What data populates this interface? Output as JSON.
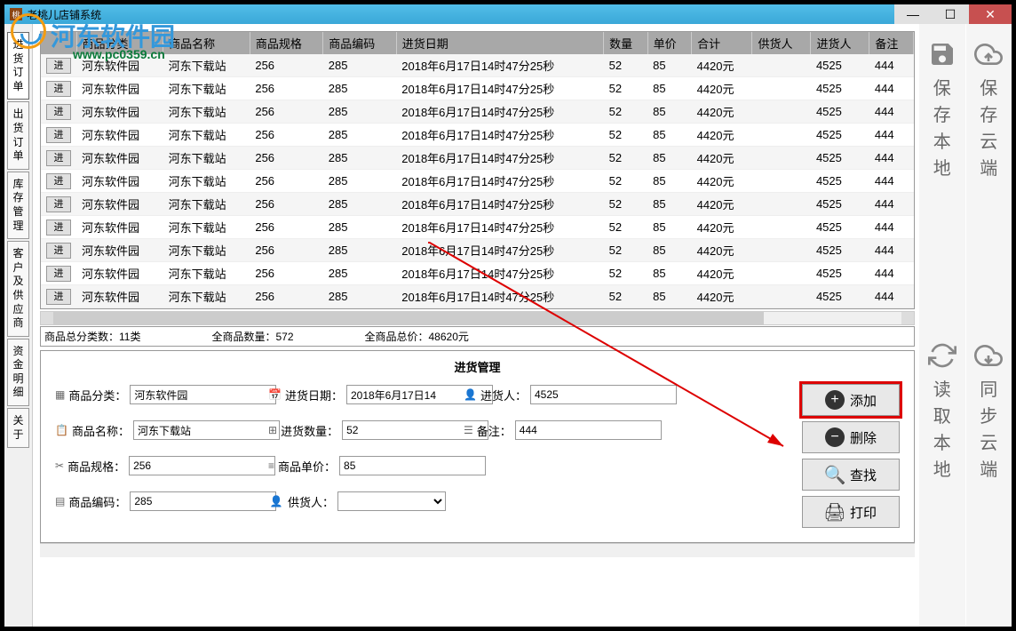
{
  "window": {
    "title": "老桃儿店铺系统",
    "icon_char": "桃"
  },
  "watermark": {
    "text": "河东软件园",
    "url": "www.pc0359.cn"
  },
  "nav_items": [
    {
      "label": "进货订单",
      "active": true
    },
    {
      "label": "出货订单",
      "active": false
    },
    {
      "label": "库存管理",
      "active": false
    },
    {
      "label": "客户及供应商",
      "active": false
    },
    {
      "label": "资金明细",
      "active": false
    },
    {
      "label": "关于",
      "active": false
    }
  ],
  "table": {
    "headers": [
      "",
      "商品分类",
      "商品名称",
      "商品规格",
      "商品编码",
      "进货日期",
      "数量",
      "单价",
      "合计",
      "供货人",
      "进货人",
      "备注"
    ],
    "row_btn": "进",
    "rows": [
      {
        "category": "河东软件园",
        "name": "河东下载站",
        "spec": "256",
        "code": "285",
        "date": "2018年6月17日14时47分25秒",
        "qty": "52",
        "price": "85",
        "total": "4420元",
        "supplier": "",
        "buyer": "4525",
        "remark": "444"
      },
      {
        "category": "河东软件园",
        "name": "河东下载站",
        "spec": "256",
        "code": "285",
        "date": "2018年6月17日14时47分25秒",
        "qty": "52",
        "price": "85",
        "total": "4420元",
        "supplier": "",
        "buyer": "4525",
        "remark": "444"
      },
      {
        "category": "河东软件园",
        "name": "河东下载站",
        "spec": "256",
        "code": "285",
        "date": "2018年6月17日14时47分25秒",
        "qty": "52",
        "price": "85",
        "total": "4420元",
        "supplier": "",
        "buyer": "4525",
        "remark": "444"
      },
      {
        "category": "河东软件园",
        "name": "河东下载站",
        "spec": "256",
        "code": "285",
        "date": "2018年6月17日14时47分25秒",
        "qty": "52",
        "price": "85",
        "total": "4420元",
        "supplier": "",
        "buyer": "4525",
        "remark": "444"
      },
      {
        "category": "河东软件园",
        "name": "河东下载站",
        "spec": "256",
        "code": "285",
        "date": "2018年6月17日14时47分25秒",
        "qty": "52",
        "price": "85",
        "total": "4420元",
        "supplier": "",
        "buyer": "4525",
        "remark": "444"
      },
      {
        "category": "河东软件园",
        "name": "河东下载站",
        "spec": "256",
        "code": "285",
        "date": "2018年6月17日14时47分25秒",
        "qty": "52",
        "price": "85",
        "total": "4420元",
        "supplier": "",
        "buyer": "4525",
        "remark": "444"
      },
      {
        "category": "河东软件园",
        "name": "河东下载站",
        "spec": "256",
        "code": "285",
        "date": "2018年6月17日14时47分25秒",
        "qty": "52",
        "price": "85",
        "total": "4420元",
        "supplier": "",
        "buyer": "4525",
        "remark": "444"
      },
      {
        "category": "河东软件园",
        "name": "河东下载站",
        "spec": "256",
        "code": "285",
        "date": "2018年6月17日14时47分25秒",
        "qty": "52",
        "price": "85",
        "total": "4420元",
        "supplier": "",
        "buyer": "4525",
        "remark": "444"
      },
      {
        "category": "河东软件园",
        "name": "河东下载站",
        "spec": "256",
        "code": "285",
        "date": "2018年6月17日14时47分25秒",
        "qty": "52",
        "price": "85",
        "total": "4420元",
        "supplier": "",
        "buyer": "4525",
        "remark": "444"
      },
      {
        "category": "河东软件园",
        "name": "河东下载站",
        "spec": "256",
        "code": "285",
        "date": "2018年6月17日14时47分25秒",
        "qty": "52",
        "price": "85",
        "total": "4420元",
        "supplier": "",
        "buyer": "4525",
        "remark": "444"
      },
      {
        "category": "河东软件园",
        "name": "河东下载站",
        "spec": "256",
        "code": "285",
        "date": "2018年6月17日14时47分25秒",
        "qty": "52",
        "price": "85",
        "total": "4420元",
        "supplier": "",
        "buyer": "4525",
        "remark": "444"
      }
    ]
  },
  "stats": {
    "categories": "商品总分类数：11类",
    "total_count": "全商品数量：572",
    "total_price": "全商品总价：48620元"
  },
  "form": {
    "title": "进货管理",
    "fields": {
      "category_label": "商品分类：",
      "category_value": "河东软件园",
      "date_label": "进货日期：",
      "date_value": "2018年6月17日14",
      "buyer_label": "进货人：",
      "buyer_value": "4525",
      "name_label": "商品名称：",
      "name_value": "河东下载站",
      "qty_label": "进货数量：",
      "qty_value": "52",
      "remark_label": "备注：",
      "remark_value": "444",
      "spec_label": "商品规格：",
      "spec_value": "256",
      "price_label": "商品单价：",
      "price_value": "85",
      "code_label": "商品编码：",
      "code_value": "285",
      "supplier_label": "供货人："
    },
    "actions": {
      "add": "添加",
      "delete": "删除",
      "search": "查找",
      "print": "打印"
    }
  },
  "right_panel": {
    "save_local": "保存本地",
    "save_cloud": "保存云端",
    "read_local": "读取本地",
    "sync_cloud": "同步云端"
  }
}
